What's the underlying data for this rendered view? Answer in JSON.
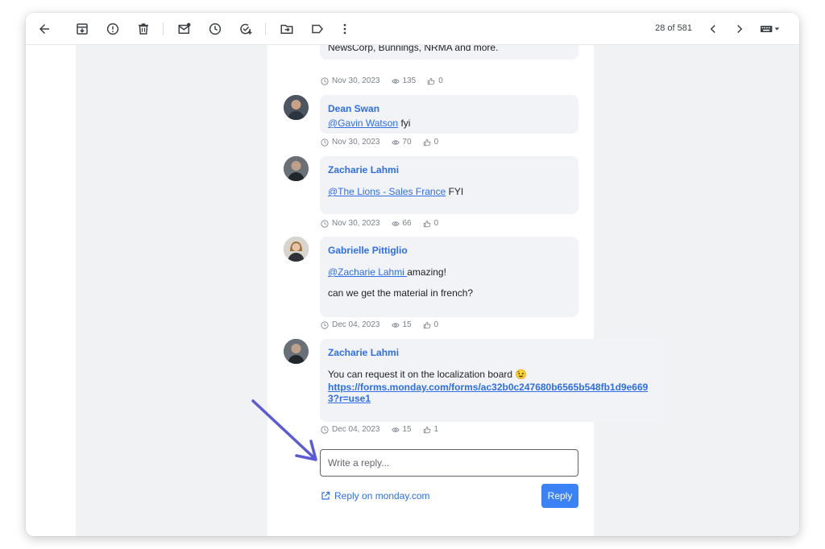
{
  "toolbar": {
    "icons": [
      "back-arrow-icon",
      "archive-icon",
      "report-spam-icon",
      "delete-icon",
      "mark-unread-icon",
      "snooze-icon",
      "add-task-icon",
      "move-to-icon",
      "label-icon",
      "more-icon"
    ],
    "pager": "28 of 581"
  },
  "thread": {
    "partial_top_text": "NewsCorp, Bunnings, NRMA and more.",
    "partial_top_meta": {
      "date": "Nov 30, 2023",
      "views": "135",
      "likes": "0"
    },
    "comments": [
      {
        "author": "Dean Swan",
        "mention": "@Gavin Watson",
        "text": " fyi",
        "date": "Nov 30, 2023",
        "views": "70",
        "likes": "0"
      },
      {
        "author": "Zacharie Lahmi",
        "mention": "@The Lions - Sales France",
        "text": " FYI",
        "date": "Nov 30, 2023",
        "views": "66",
        "likes": "0"
      },
      {
        "author": "Gabrielle Pittiglio",
        "mention": "@Zacharie Lahmi ",
        "text": "amazing!",
        "text2": "can we get the material in french?",
        "date": "Dec 04, 2023",
        "views": "15",
        "likes": "0"
      },
      {
        "author": "Zacharie Lahmi",
        "text": "You can request it on the localization board 😉",
        "link": "https://forms.monday.com/forms/ac32b0c247680b6565b548fb1d9e6693?r=use1",
        "date": "Dec 04, 2023",
        "views": "15",
        "likes": "1"
      }
    ]
  },
  "reply": {
    "placeholder": "Write a reply...",
    "external_link": "Reply on monday.com",
    "button": "Reply"
  },
  "colors": {
    "accent": "#2f6ee6",
    "button": "#3b82f6",
    "arrow": "#5b5bd6"
  }
}
